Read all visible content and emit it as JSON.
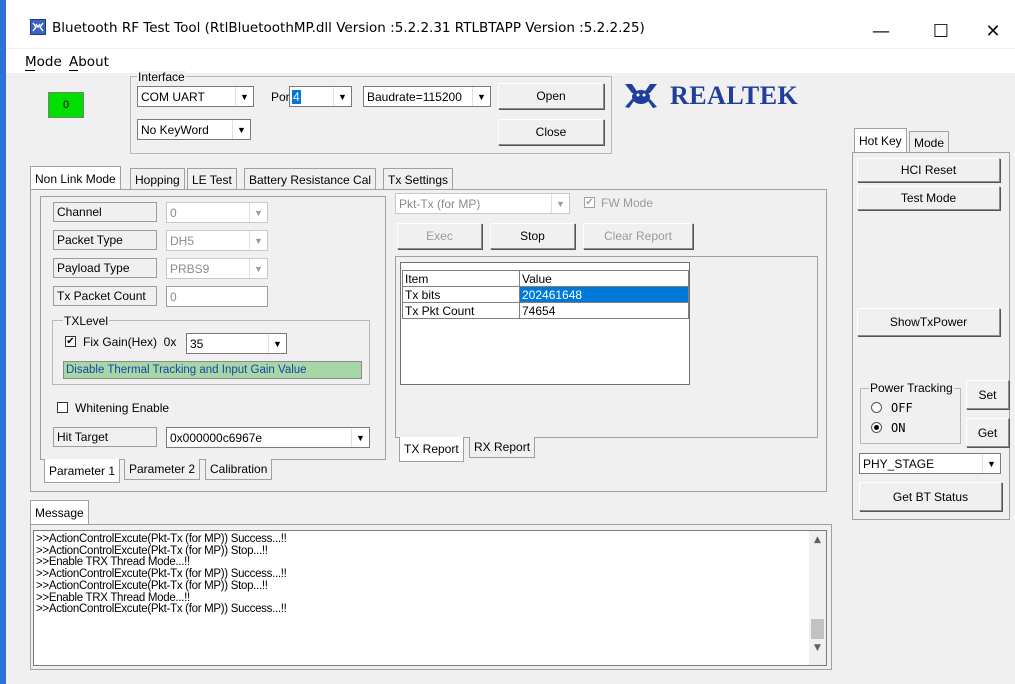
{
  "window": {
    "title": "Bluetooth RF Test Tool (RtlBluetoothMP.dll Version :5.2.2.31   RTLBTAPP Version :5.2.2.25)",
    "minimize": "—",
    "maximize": "☐",
    "close": "✕"
  },
  "menu": {
    "mode": "Mode",
    "about": "About"
  },
  "status_indicator": {
    "value": "0",
    "color": "#00e000"
  },
  "interface": {
    "legend": "Interface",
    "type": "COM UART",
    "port_label": "Port",
    "port": "4",
    "baudrate": "Baudrate=115200",
    "keyword": "No KeyWord",
    "open_label": "Open",
    "close_label": "Close"
  },
  "logo": {
    "text": "REALTEK",
    "color": "#1f3f9a"
  },
  "main_tabs": [
    "Non Link Mode",
    "Hopping",
    "LE Test",
    "Battery Resistance Cal",
    "Tx Settings"
  ],
  "params": {
    "channel_label": "Channel",
    "channel": "0",
    "packet_type_label": "Packet Type",
    "packet_type": "DH5",
    "payload_type_label": "Payload Type",
    "payload_type": "PRBS9",
    "tx_packet_count_label": "Tx Packet Count",
    "tx_packet_count": "0",
    "txlevel_legend": "TXLevel",
    "fix_gain_label": "Fix Gain(Hex)  0x",
    "fix_gain_value": "35",
    "disable_thermal": "Disable Thermal Tracking and Input Gain Value",
    "whitening_label": "Whitening Enable",
    "hit_target_label": "Hit Target",
    "hit_target": "0x000000c6967e"
  },
  "param_tabs": [
    "Parameter 1",
    "Parameter 2",
    "Calibration"
  ],
  "test": {
    "mode": "Pkt-Tx (for MP)",
    "fw_mode_label": "FW Mode",
    "exec_label": "Exec",
    "stop_label": "Stop",
    "clear_label": "Clear Report"
  },
  "report": {
    "headers": [
      "Item",
      "Value"
    ],
    "rows": [
      {
        "item": "Tx bits",
        "value": "202461648"
      },
      {
        "item": "Tx Pkt Count",
        "value": "74654"
      }
    ],
    "selection_color": "#0078d7"
  },
  "report_tabs": [
    "TX Report",
    "RX Report"
  ],
  "message": {
    "tab": "Message",
    "lines": [
      ">>ActionControlExcute(Pkt-Tx (for MP)) Success...!!",
      ">>ActionControlExcute(Pkt-Tx (for MP)) Stop...!!",
      ">>Enable TRX Thread Mode...!!",
      ">>ActionControlExcute(Pkt-Tx (for MP)) Success...!!",
      ">>ActionControlExcute(Pkt-Tx (for MP)) Stop...!!",
      ">>Enable TRX Thread Mode...!!",
      ">>ActionControlExcute(Pkt-Tx (for MP)) Success...!!"
    ]
  },
  "right_tabs": [
    "Hot Key",
    "Mode"
  ],
  "hotkey": {
    "hci_reset": "HCI Reset",
    "test_mode": "Test Mode",
    "show_tx_power": "ShowTxPower",
    "power_tracking_legend": "Power Tracking",
    "off_label": "OFF",
    "on_label": "ON",
    "set_label": "Set",
    "get_label": "Get",
    "stage": "PHY_STAGE",
    "get_bt_status": "Get BT Status"
  }
}
